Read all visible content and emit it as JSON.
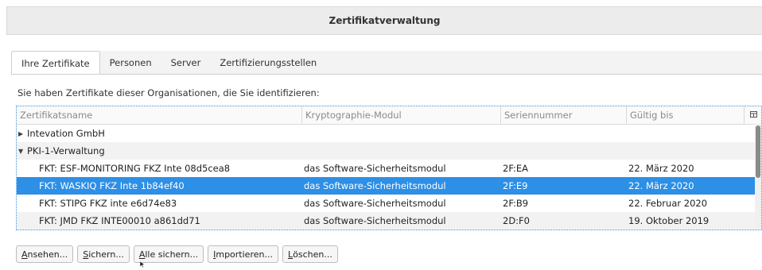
{
  "window": {
    "title": "Zertifikatverwaltung"
  },
  "tabs": [
    {
      "label": "Ihre Zertifikate",
      "active": true
    },
    {
      "label": "Personen",
      "active": false
    },
    {
      "label": "Server",
      "active": false
    },
    {
      "label": "Zertifizierungsstellen",
      "active": false
    }
  ],
  "intro_text": "Sie haben Zertifikate dieser Organisationen, die Sie identifizieren:",
  "table": {
    "columns": [
      "Zertifikatsname",
      "Kryptographie-Modul",
      "Seriennummer",
      "Gültig bis"
    ],
    "groups": [
      {
        "name": "Intevation GmbH",
        "expanded": false
      },
      {
        "name": "PKI-1-Verwaltung",
        "expanded": true
      }
    ],
    "rows": [
      {
        "name": "FKT: ESF-MONITORING FKZ Inte 08d5cea8",
        "module": "das Software-Sicherheitsmodul",
        "serial": "2F:EA",
        "valid": "22. März 2020",
        "selected": false
      },
      {
        "name": "FKT: WASKIQ FKZ Inte 1b84ef40",
        "module": "das Software-Sicherheitsmodul",
        "serial": "2F:E9",
        "valid": "22. März 2020",
        "selected": true
      },
      {
        "name": "FKT: STIPG FKZ inte e6d74e83",
        "module": "das Software-Sicherheitsmodul",
        "serial": "2F:B9",
        "valid": "22. Februar 2020",
        "selected": false
      },
      {
        "name": "FKT: JMD FKZ INTE00010 a861dd71",
        "module": "das Software-Sicherheitsmodul",
        "serial": "2D:F0",
        "valid": "19. Oktober 2019",
        "selected": false
      }
    ]
  },
  "buttons": {
    "view": {
      "accel": "A",
      "rest": "nsehen..."
    },
    "backup": {
      "accel": "S",
      "rest": "ichern..."
    },
    "backup_all": {
      "accel": "A",
      "rest": "lle sichern..."
    },
    "import": {
      "accel": "I",
      "rest": "mportieren..."
    },
    "delete": {
      "accel": "L",
      "rest": "öschen..."
    }
  },
  "colors": {
    "selection": "#2d8fe6",
    "focus_border": "#3b8fd9"
  },
  "icons": {
    "collapsed_twisty": "triangle-right",
    "expanded_twisty": "triangle-down",
    "column_picker": "column-picker-icon"
  }
}
